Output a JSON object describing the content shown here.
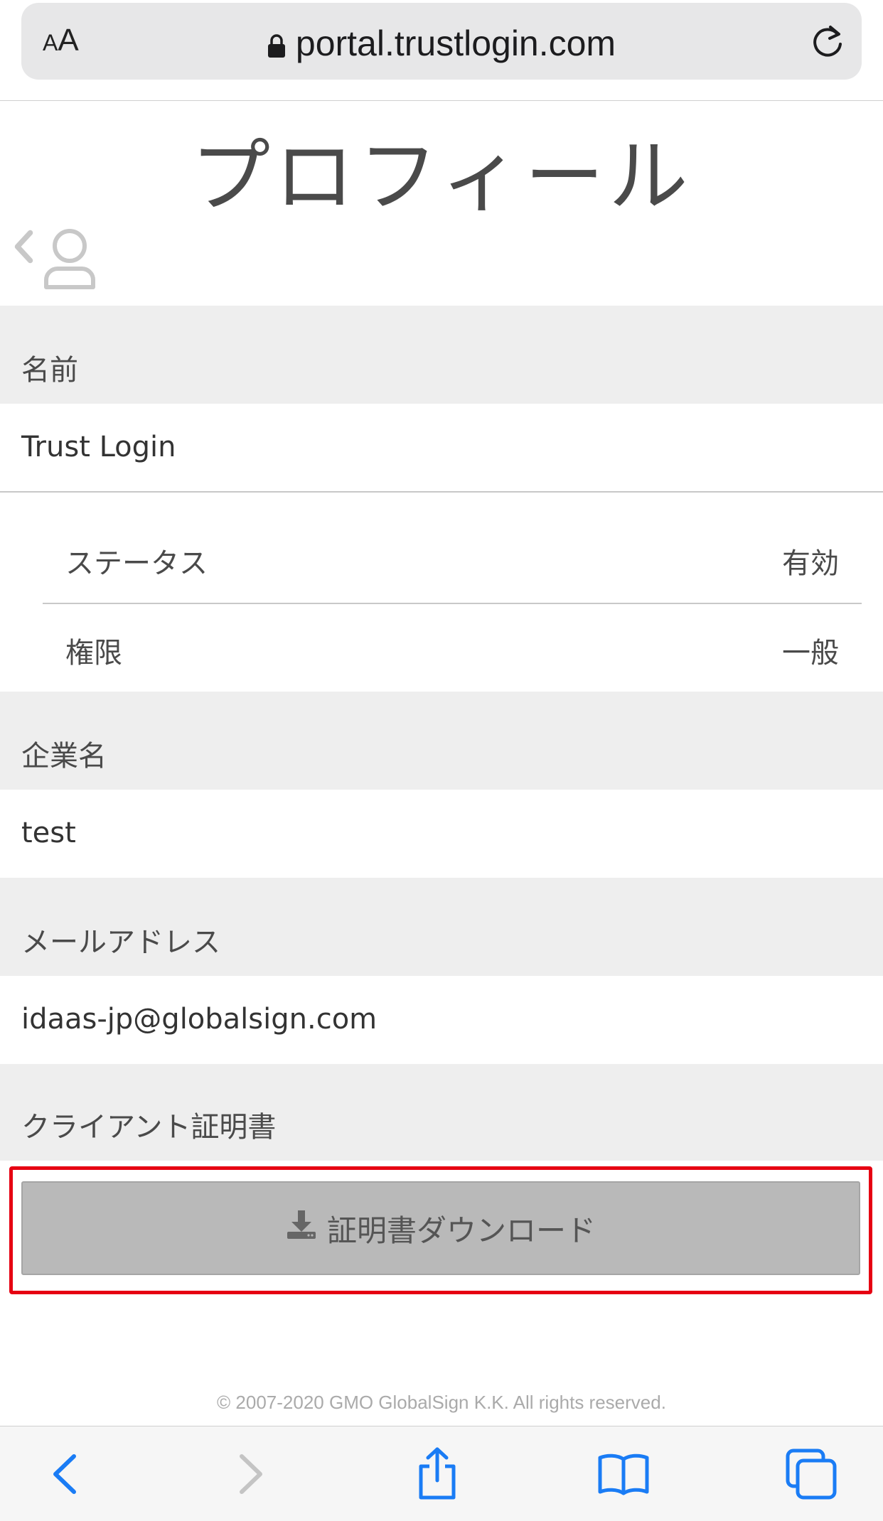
{
  "browser": {
    "aa_label_small": "A",
    "aa_label_large": "A",
    "url": "portal.trustlogin.com",
    "accent_color": "#1a7cf5"
  },
  "page": {
    "title": "プロフィール"
  },
  "profile": {
    "name_label": "名前",
    "name_value": "Trust Login",
    "status_label": "ステータス",
    "status_value": "有効",
    "role_label": "権限",
    "role_value": "一般",
    "company_label": "企業名",
    "company_value": "test",
    "email_label": "メールアドレス",
    "email_value": "idaas-jp@globalsign.com",
    "cert_label": "クライアント証明書",
    "download_label": "証明書ダウンロード"
  },
  "footer": {
    "copyright": "© 2007-2020 GMO GlobalSign K.K. All rights reserved."
  },
  "icons": {
    "lock": "lock-icon",
    "reload": "reload-icon",
    "back": "chevron-left-icon",
    "user": "user-icon",
    "download": "download-icon",
    "nav_back": "chevron-left-icon",
    "nav_forward": "chevron-right-icon",
    "share": "share-icon",
    "bookmarks": "book-icon",
    "tabs": "tabs-icon"
  },
  "colors": {
    "highlight_border": "#e60012",
    "section_header_bg": "#eeeeee",
    "button_bg": "#b9b9b9"
  }
}
